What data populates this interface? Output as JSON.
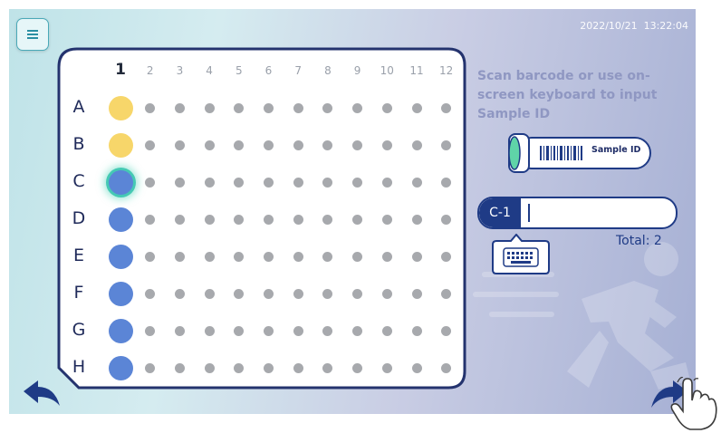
{
  "datetime": "2022/10/21  13:22:04",
  "plate": {
    "columns": [
      "1",
      "2",
      "3",
      "4",
      "5",
      "6",
      "7",
      "8",
      "9",
      "10",
      "11",
      "12"
    ],
    "active_column": "1",
    "rows": [
      "A",
      "B",
      "C",
      "D",
      "E",
      "F",
      "G",
      "H"
    ],
    "column1_wells": [
      {
        "row": "A",
        "state": "yellow"
      },
      {
        "row": "B",
        "state": "yellow"
      },
      {
        "row": "C",
        "state": "current"
      },
      {
        "row": "D",
        "state": "blue"
      },
      {
        "row": "E",
        "state": "blue"
      },
      {
        "row": "F",
        "state": "blue"
      },
      {
        "row": "G",
        "state": "blue"
      },
      {
        "row": "H",
        "state": "blue"
      }
    ]
  },
  "instruction": "Scan barcode or use on-screen keyboard to input Sample ID",
  "tube_label": "Sample ID",
  "sample_input": {
    "prefix": "C-1",
    "value": ""
  },
  "total_label": "Total: 2",
  "colors": {
    "navy": "#1f3b86",
    "yellow_well": "#f7d66a",
    "blue_well": "#5b85d6",
    "empty_well": "#a7a9ad",
    "highlight": "#45c9b4"
  },
  "icons": {
    "menu": "hamburger-icon",
    "keyboard": "keyboard-icon",
    "back": "back-arrow-icon",
    "next": "forward-arrow-icon",
    "pointer": "hand-pointer-icon",
    "decoration": "runner-icon"
  }
}
